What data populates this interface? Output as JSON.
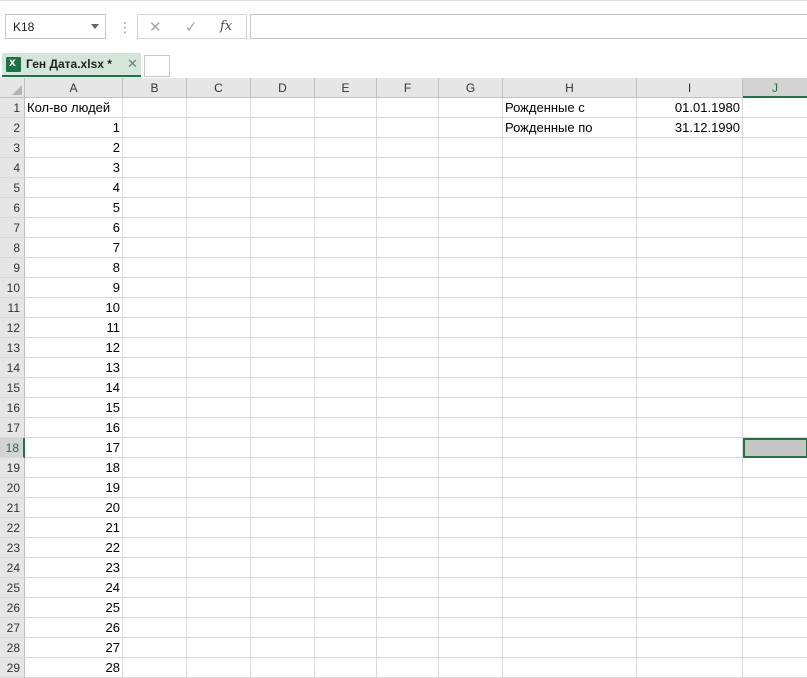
{
  "formula_bar": {
    "name_box": "K18",
    "separator": "⋮",
    "cancel_icon": "✕",
    "enter_icon": "✓",
    "fx_label": "fx",
    "formula_value": ""
  },
  "workbook_tab": {
    "icon": "excel-icon",
    "title": "Ген Дата.xlsx *",
    "close": "✕"
  },
  "columns": [
    "A",
    "B",
    "C",
    "D",
    "E",
    "F",
    "G",
    "H",
    "I",
    "J"
  ],
  "active_column": "J",
  "active_row": 18,
  "rows": [
    "1",
    "2",
    "3",
    "4",
    "5",
    "6",
    "7",
    "8",
    "9",
    "10",
    "11",
    "12",
    "13",
    "14",
    "15",
    "16",
    "17",
    "18",
    "19",
    "20",
    "21",
    "22",
    "23",
    "24",
    "25",
    "26",
    "27",
    "28",
    "29"
  ],
  "cells": {
    "A1": "Кол-во людей",
    "A2": "1",
    "A3": "2",
    "A4": "3",
    "A5": "4",
    "A6": "5",
    "A7": "6",
    "A8": "7",
    "A9": "8",
    "A10": "9",
    "A11": "10",
    "A12": "11",
    "A13": "12",
    "A14": "13",
    "A15": "14",
    "A16": "15",
    "A17": "16",
    "A18": "17",
    "A19": "18",
    "A20": "19",
    "A21": "20",
    "A22": "21",
    "A23": "22",
    "A24": "23",
    "A25": "24",
    "A26": "25",
    "A27": "26",
    "A28": "27",
    "A29": "28",
    "H1": "Рожденные с",
    "I1": "01.01.1980",
    "H2": "Рожденные по",
    "I2": "31.12.1990"
  },
  "colors": {
    "accent": "#217346",
    "header_bg": "#e6e6e6",
    "gridline": "#d9d9d9",
    "selected_fill": "#c6c6c6"
  }
}
